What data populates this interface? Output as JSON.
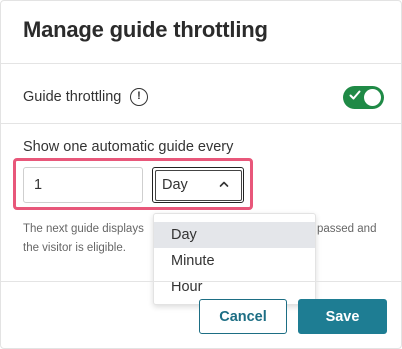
{
  "modal": {
    "title": "Manage guide throttling"
  },
  "throttling": {
    "label": "Guide throttling",
    "info_icon": "info-circle-icon",
    "toggle_on": true
  },
  "frequency": {
    "label": "Show one automatic guide every",
    "count_value": "1",
    "unit_selected": "Day",
    "options": [
      "Day",
      "Minute",
      "Hour"
    ]
  },
  "help": {
    "line1_start": "The next guide displays",
    "line1_end": "passed and",
    "line2": "the visitor is eligible."
  },
  "footer": {
    "cancel_label": "Cancel",
    "save_label": "Save"
  },
  "colors": {
    "toggle_on": "#1f8a46",
    "primary": "#1e7d93",
    "highlight": "#e8577a"
  }
}
